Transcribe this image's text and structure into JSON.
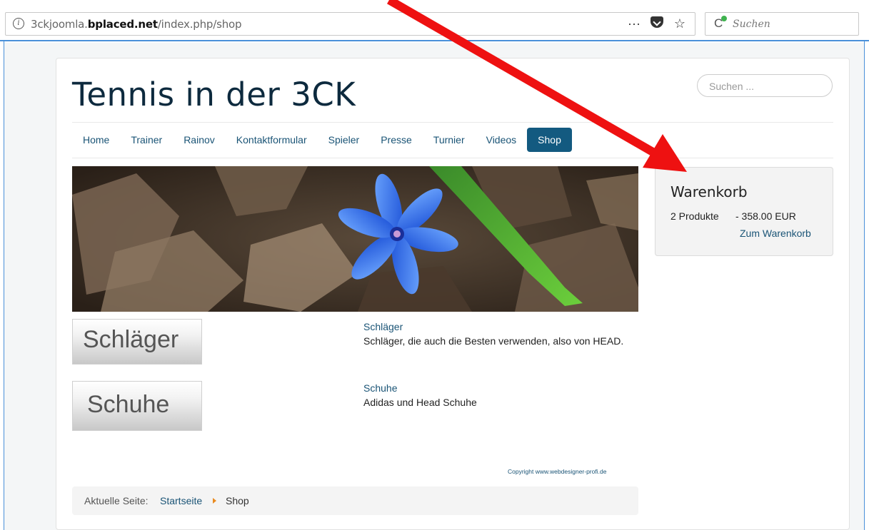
{
  "browser": {
    "url_prefix": "3ckjoomla.",
    "url_domain": "bplaced.net",
    "url_path": "/index.php/shop",
    "more_icon": "···",
    "search_placeholder": "Suchen"
  },
  "site": {
    "title": "Tennis in der 3CK",
    "search_placeholder": "Suchen ..."
  },
  "nav": {
    "items": [
      {
        "label": "Home"
      },
      {
        "label": "Trainer"
      },
      {
        "label": "Rainov"
      },
      {
        "label": "Kontaktformular"
      },
      {
        "label": "Spieler"
      },
      {
        "label": "Presse"
      },
      {
        "label": "Turnier"
      },
      {
        "label": "Videos"
      },
      {
        "label": "Shop"
      }
    ],
    "active": "Shop",
    "active_color": "#135a80"
  },
  "categories": [
    {
      "image_text": "Schläger",
      "link": "Schläger",
      "description": "Schläger, die auch die Besten verwenden, also von HEAD."
    },
    {
      "image_text": "Schuhe",
      "link": "Schuhe",
      "description": "Adidas und Head Schuhe"
    }
  ],
  "copyright": "Copyright www.webdesigner-profi.de",
  "breadcrumb": {
    "label": "Aktuelle Seite:",
    "home": "Startseite",
    "current": "Shop"
  },
  "cart": {
    "title": "Warenkorb",
    "count": "2 Produkte",
    "total": "- 358.00 EUR",
    "link": "Zum Warenkorb"
  },
  "colors": {
    "link": "#1a5476",
    "annotation_arrow": "#ee1111"
  }
}
